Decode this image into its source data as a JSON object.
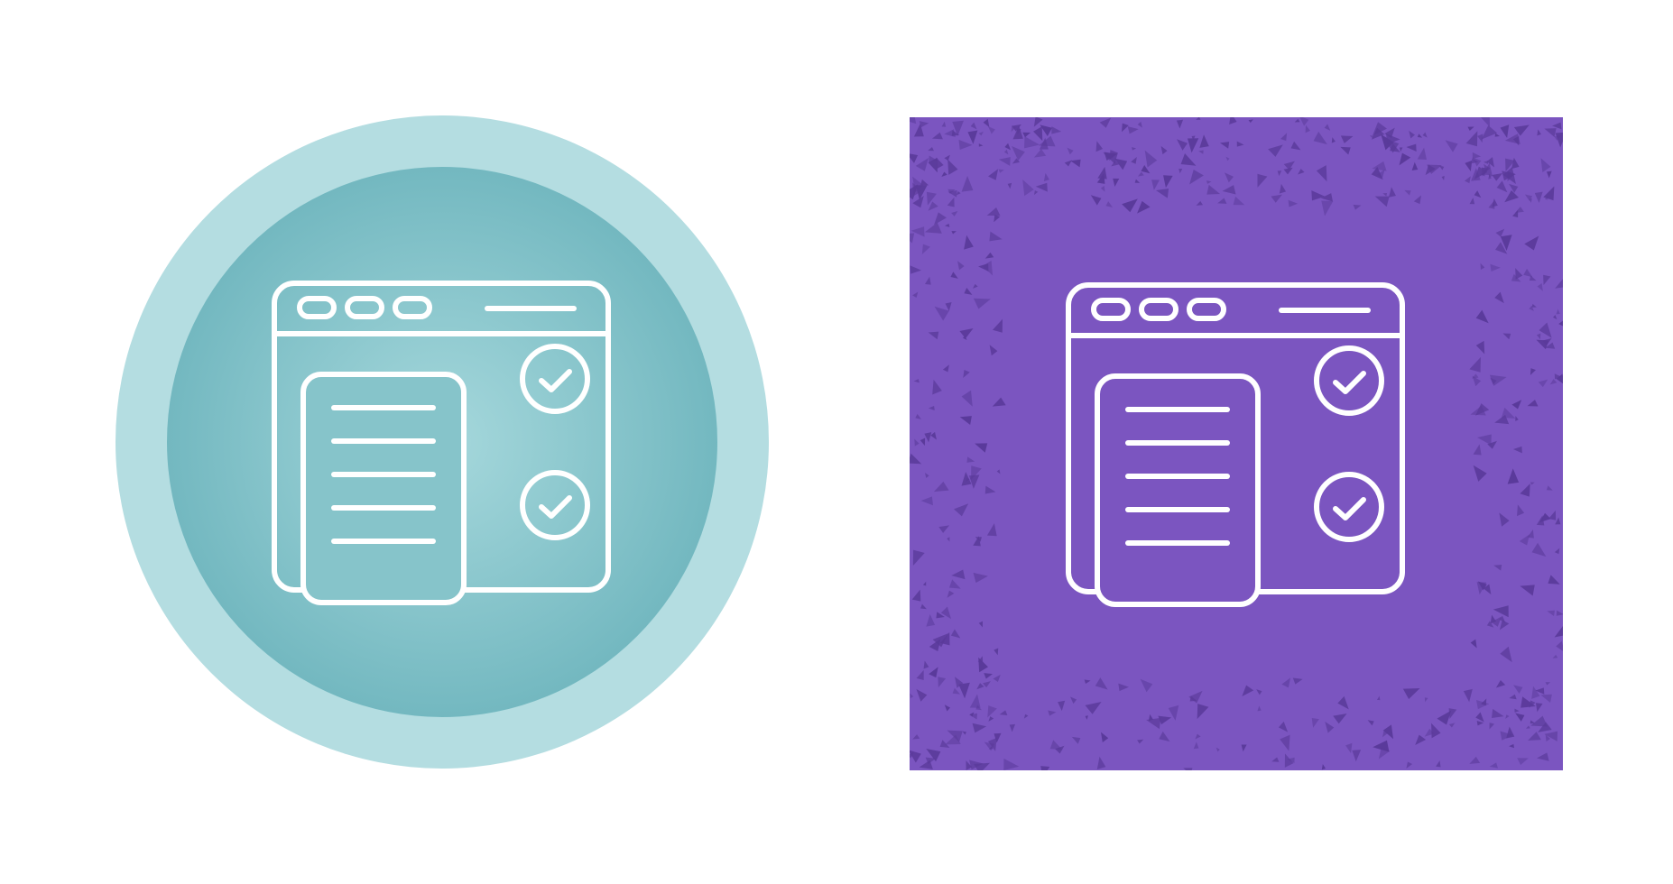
{
  "icons": [
    {
      "name": "circle-variant",
      "icon": "browser-checklist-icon",
      "colors": {
        "outer_ring": "#b4dde1",
        "inner_disc_center": "#a6d8dc",
        "inner_disc_edge": "#73b8c0",
        "stroke": "#ffffff"
      }
    },
    {
      "name": "square-variant",
      "icon": "browser-checklist-icon",
      "colors": {
        "background": "#7b55c0",
        "texture": "#5a3a9a",
        "stroke": "#ffffff"
      }
    }
  ]
}
